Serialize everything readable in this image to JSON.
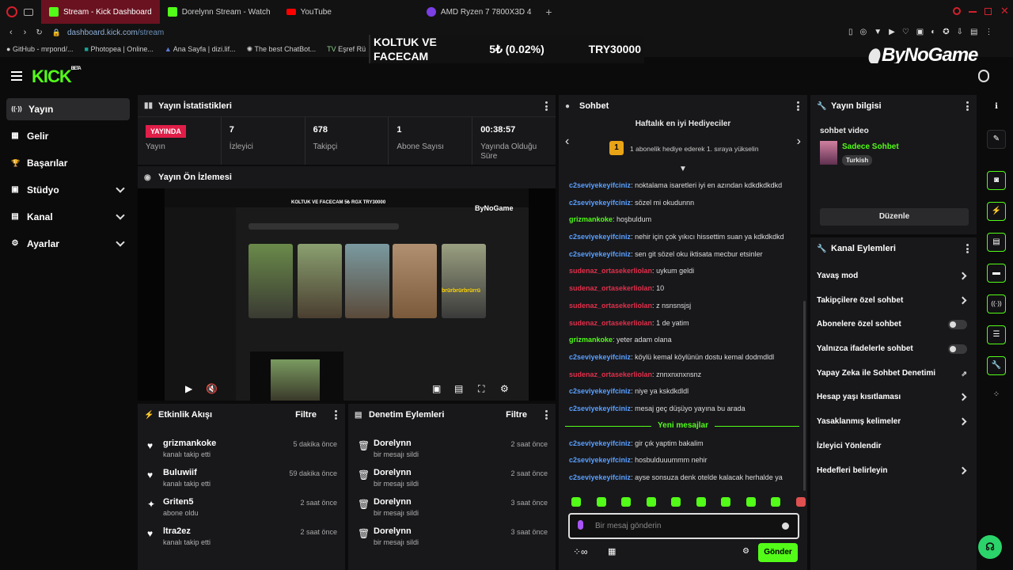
{
  "browser": {
    "tabs": [
      {
        "label": "Stream - Kick Dashboard",
        "active": true,
        "color": "#53fc18"
      },
      {
        "label": "Dorelynn Stream - Watch",
        "active": false,
        "color": "#53fc18"
      },
      {
        "label": "YouTube",
        "active": false,
        "color": "#ff0000"
      },
      {
        "label": "AMD Ryzen 7 7800X3D 4",
        "active": false,
        "color": "#7b3fe4"
      }
    ],
    "url_host": "dashboard.kick.com",
    "url_path": "/stream",
    "bookmarks": [
      "GitHub - mrpond/...",
      "Photopea | Online...",
      "Ana Sayfa | dizi.lif...",
      "The best ChatBot...",
      "Eşref Rü"
    ]
  },
  "overlay": {
    "ticker_label": "KOLTUK VE FACECAM",
    "ticker_amount": "5₺ (0.02%)",
    "ticker_goal": "TRY30000",
    "brand": "ByNoGame"
  },
  "header": {
    "logo": "KICK",
    "logo_badge": "BETA"
  },
  "sidebar": {
    "items": [
      {
        "label": "Yayın",
        "icon": "((·))",
        "active": true,
        "chevron": false
      },
      {
        "label": "Gelir",
        "icon": "▦",
        "active": false,
        "chevron": false
      },
      {
        "label": "Başarılar",
        "icon": "🏆",
        "active": false,
        "chevron": false
      },
      {
        "label": "Stüdyo",
        "icon": "▣",
        "active": false,
        "chevron": true
      },
      {
        "label": "Kanal",
        "icon": "▤",
        "active": false,
        "chevron": true
      },
      {
        "label": "Ayarlar",
        "icon": "⚙",
        "active": false,
        "chevron": true
      }
    ]
  },
  "stats_panel": {
    "title": "Yayın İstatistikleri",
    "live_badge": "YAYINDA",
    "live_label": "Yayın",
    "stats": [
      {
        "value": "7",
        "label": "İzleyici"
      },
      {
        "value": "678",
        "label": "Takipçi"
      },
      {
        "value": "1",
        "label": "Abone Sayısı"
      },
      {
        "value": "00:38:57",
        "label": "Yayında Olduğu Süre"
      }
    ]
  },
  "preview_panel": {
    "title": "Yayın Ön İzlemesi",
    "mini_ticker": "KOLTUK VE FACECAM    5₺    RGX    TRY30000",
    "mini_brand": "ByNoGame",
    "thumb_caption": "brürbrürbrürrü"
  },
  "activity_panel": {
    "title": "Etkinlik Akışı",
    "filter_label": "Filtre",
    "items": [
      {
        "name": "grizmankoke",
        "sub": "kanalı takip etti",
        "time": "5 dakika önce",
        "icon": "heart-icon"
      },
      {
        "name": "Buluwiif",
        "sub": "kanalı takip etti",
        "time": "59 dakika önce",
        "icon": "heart-icon"
      },
      {
        "name": "Griten5",
        "sub": "abone oldu",
        "time": "2 saat önce",
        "icon": "sparkle-icon"
      },
      {
        "name": "ltra2ez",
        "sub": "kanalı takip etti",
        "time": "2 saat önce",
        "icon": "heart-icon"
      }
    ]
  },
  "moderation_panel": {
    "title": "Denetim Eylemleri",
    "filter_label": "Filtre",
    "items": [
      {
        "name": "Dorelynn",
        "sub": "bir mesajı sildi",
        "time": "2 saat önce"
      },
      {
        "name": "Dorelynn",
        "sub": "bir mesajı sildi",
        "time": "2 saat önce"
      },
      {
        "name": "Dorelynn",
        "sub": "bir mesajı sildi",
        "time": "3 saat önce"
      },
      {
        "name": "Dorelynn",
        "sub": "bir mesajı sildi",
        "time": "3 saat önce"
      }
    ]
  },
  "chat": {
    "title": "Sohbet",
    "gift_title": "Haftalık en iyi Hediyeciler",
    "gift_rank": "1",
    "gift_text": "1 abonelik hediye ederek 1. sıraya yükselin",
    "messages": [
      {
        "user": "c2seviyekeyifciniz",
        "text": "noktalama isaretleri iyi en azından kdkdkdkdkd",
        "color": "#5aa0ff"
      },
      {
        "user": "c2seviyekeyifciniz",
        "text": "sözel mi okudunnn",
        "color": "#5aa0ff"
      },
      {
        "user": "grizmankoke",
        "text": "hoşbuldum",
        "color": "#53fc18"
      },
      {
        "user": "c2seviyekeyifciniz",
        "text": "nehir için çok yıkıcı hissettim suan ya kdkdkdkd",
        "color": "#5aa0ff"
      },
      {
        "user": "c2seviyekeyifciniz",
        "text": "sen git sözel oku iktisata mecbur etsinler",
        "color": "#5aa0ff"
      },
      {
        "user": "sudenaz_ortasekerliolan",
        "text": "uykum geldi",
        "color": "#e0304a"
      },
      {
        "user": "sudenaz_ortasekerliolan",
        "text": "10",
        "color": "#e0304a"
      },
      {
        "user": "sudenaz_ortasekerliolan",
        "text": "z nsnsnsjsj",
        "color": "#e0304a"
      },
      {
        "user": "sudenaz_ortasekerliolan",
        "text": "1 de yatim",
        "color": "#e0304a"
      },
      {
        "user": "grizmankoke",
        "text": "yeter adam olana",
        "color": "#53fc18"
      },
      {
        "user": "c2seviyekeyifciniz",
        "text": "köylü kemal köylünün dostu kemal dodmdldl",
        "color": "#5aa0ff"
      },
      {
        "user": "sudenaz_ortasekerliolan",
        "text": "znnxnxnxnsnz",
        "color": "#e0304a"
      },
      {
        "user": "c2seviyekeyifciniz",
        "text": "niye ya kskdkdldl",
        "color": "#5aa0ff"
      },
      {
        "user": "c2seviyekeyifciniz",
        "text": "mesaj geç düşüyo yayına bu arada",
        "color": "#5aa0ff"
      }
    ],
    "new_messages_label": "Yeni mesajlar",
    "new_messages": [
      {
        "user": "c2seviyekeyifciniz",
        "text": "gir çık yaptim bakalim",
        "color": "#5aa0ff"
      },
      {
        "user": "c2seviyekeyifciniz",
        "text": "hosbulduuummm nehir",
        "color": "#5aa0ff"
      },
      {
        "user": "c2seviyekeyifciniz",
        "text": "ayse sonsuza denk otelde kalacak herhalde ya",
        "color": "#5aa0ff"
      }
    ],
    "input_placeholder": "Bir mesaj gönderin",
    "send_label": "Gönder"
  },
  "stream_info": {
    "title": "Yayın bilgisi",
    "stream_title": "sohbet video",
    "category": "Sadece Sohbet",
    "language": "Turkish",
    "edit_label": "Düzenle"
  },
  "channel_actions": {
    "title": "Kanal Eylemleri",
    "items": [
      {
        "label": "Yavaş mod",
        "type": "chevron"
      },
      {
        "label": "Takipçilere özel sohbet",
        "type": "chevron"
      },
      {
        "label": "Abonelere özel sohbet",
        "type": "toggle"
      },
      {
        "label": "Yalnızca ifadelerle sohbet",
        "type": "toggle"
      },
      {
        "label": "Yapay Zeka ile Sohbet Denetimi",
        "type": "external"
      },
      {
        "label": "Hesap yaşı kısıtlaması",
        "type": "chevron"
      },
      {
        "label": "Yasaklanmış kelimeler",
        "type": "chevron"
      },
      {
        "label": "İzleyici Yönlendir",
        "type": "none"
      },
      {
        "label": "Hedefleri belirleyin",
        "type": "chevron"
      }
    ]
  },
  "accent_color": "#53fc18",
  "live_color": "#e01e48"
}
